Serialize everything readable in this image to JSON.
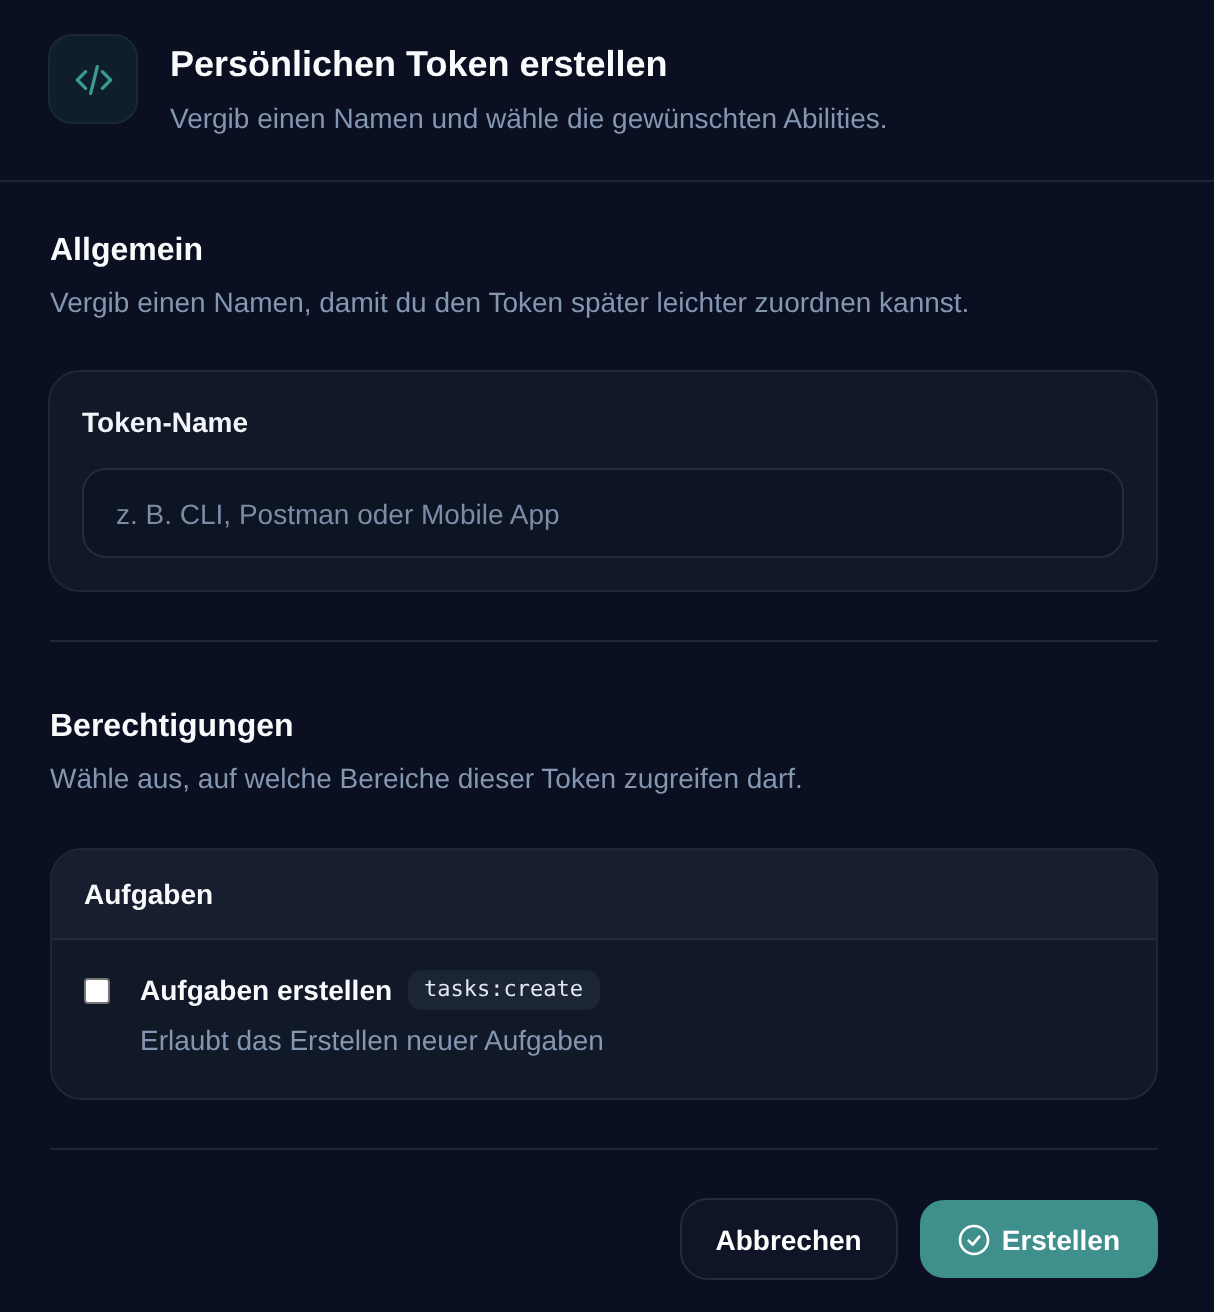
{
  "header": {
    "title": "Persönlichen Token erstellen",
    "subtitle": "Vergib einen Namen und wähle die gewünschten Abilities."
  },
  "general": {
    "title": "Allgemein",
    "description": "Vergib einen Namen, damit du den Token später leichter zuordnen kannst.",
    "field": {
      "label": "Token-Name",
      "placeholder": "z. B. CLI, Postman oder Mobile App"
    }
  },
  "permissions": {
    "title": "Berechtigungen",
    "description": "Wähle aus, auf welche Bereiche dieser Token zugreifen darf.",
    "groups": [
      {
        "title": "Aufgaben",
        "abilities": [
          {
            "label": "Aufgaben erstellen",
            "code": "tasks:create",
            "description": "Erlaubt das Erstellen neuer Aufgaben",
            "checked": false
          }
        ]
      }
    ]
  },
  "actions": [
    {
      "label": "Abbrechen",
      "kind": "secondary"
    },
    {
      "label": "Erstellen",
      "kind": "primary"
    }
  ]
}
